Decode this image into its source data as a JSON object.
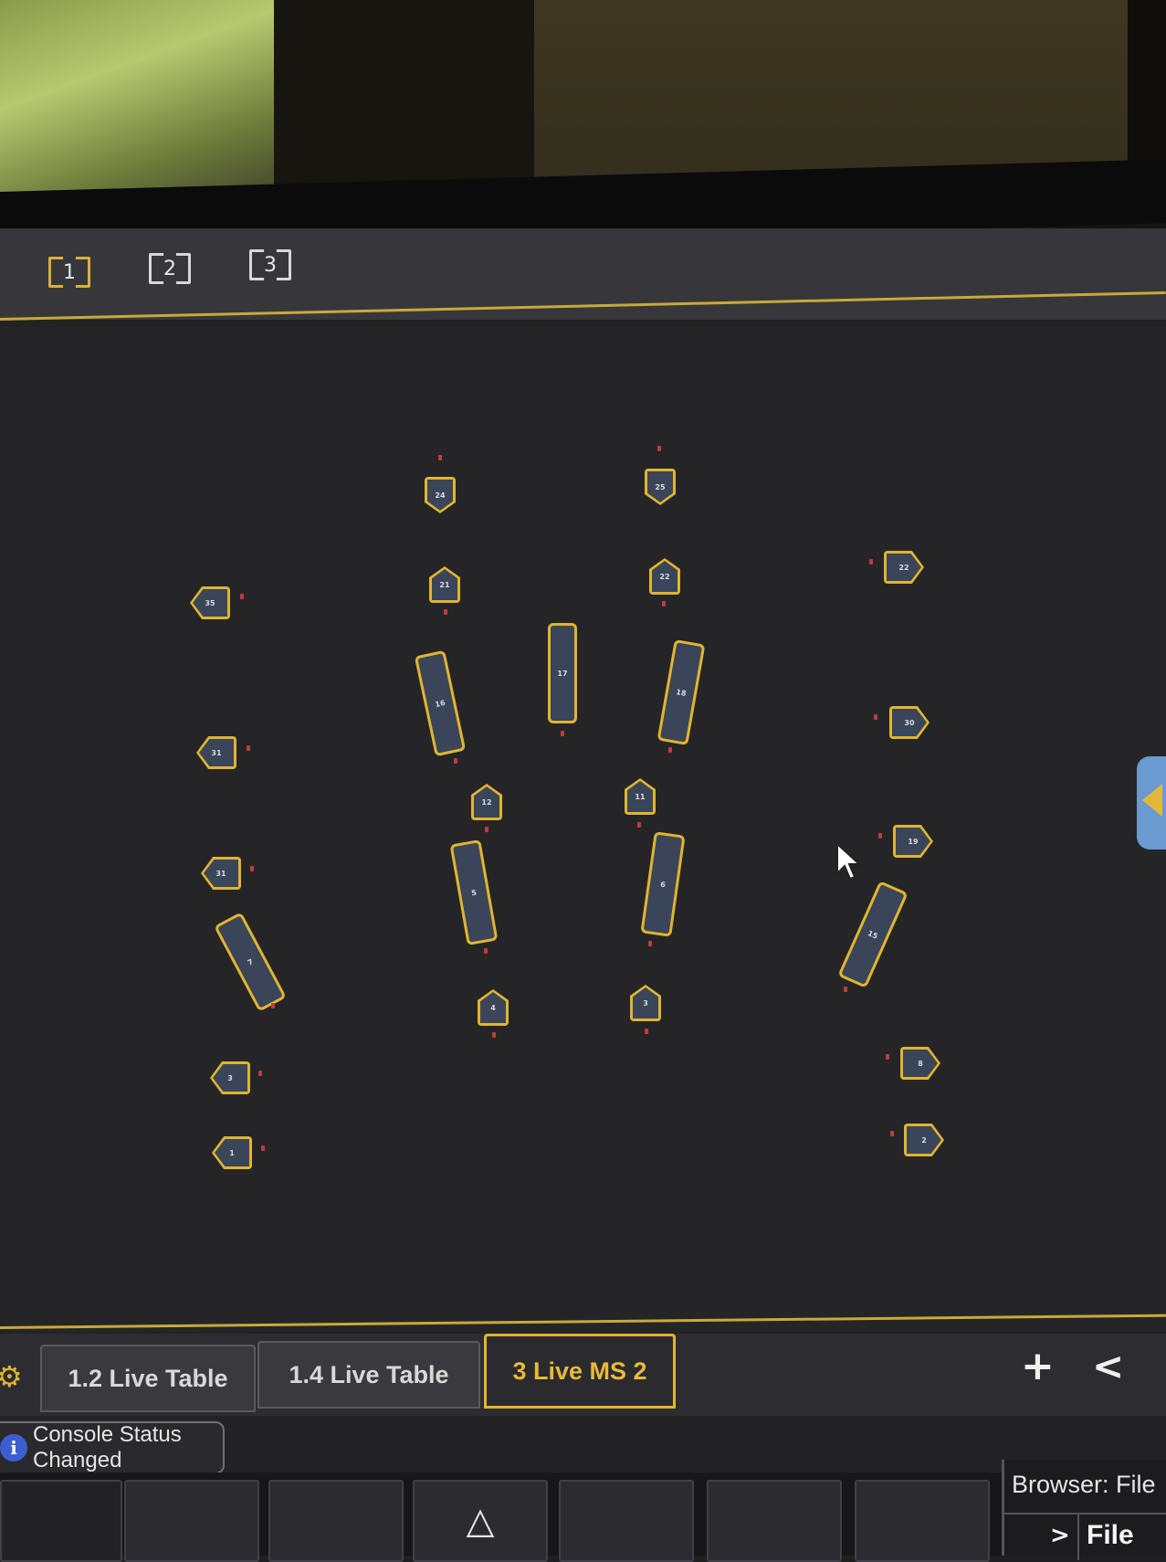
{
  "layout_buttons": [
    "1",
    "2",
    "3"
  ],
  "fixtures": {
    "f24": "24",
    "f25": "25",
    "f21": "21",
    "f22a": "22",
    "f22b": "22",
    "f35": "35",
    "f17": "17",
    "f16": "16",
    "f18": "18",
    "f30": "30",
    "f31a": "31",
    "f12": "12",
    "f11": "11",
    "f19": "19",
    "f31b": "31",
    "f5": "5",
    "f6": "6",
    "f15": "15",
    "f7": "7",
    "f4": "4",
    "f3": "3",
    "f8": "8",
    "f1": "1",
    "f2": "2"
  },
  "tabs": [
    {
      "label": "1.2 Live Table"
    },
    {
      "label": "1.4 Live Table"
    },
    {
      "label": "3 Live MS 2"
    }
  ],
  "tab_actions": {
    "add": "+",
    "collapse": "<"
  },
  "status": {
    "line1": "Console Status",
    "line2": "Changed",
    "icon": "i"
  },
  "softkeys": {
    "up_arrow": "△"
  },
  "browser": {
    "header": "Browser: File",
    "chevron": ">",
    "item": "File"
  },
  "colors": {
    "accent": "#e0b52f",
    "fixture_fill": "#3b4559",
    "background": "#252528"
  }
}
